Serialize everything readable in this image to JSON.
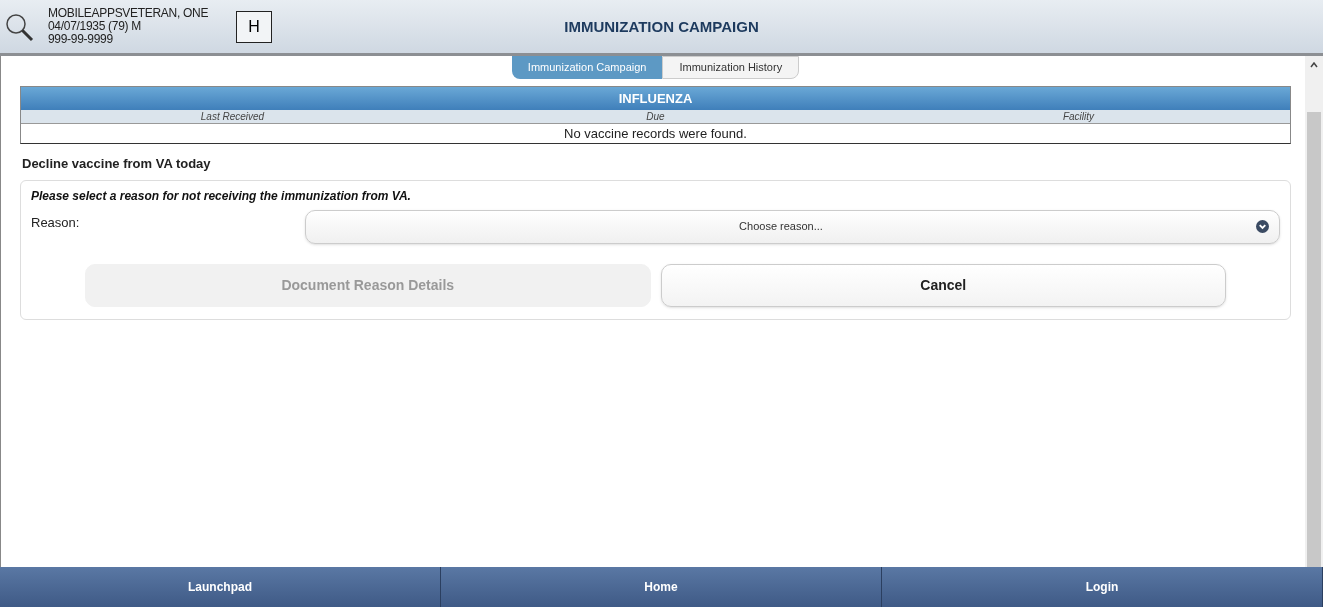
{
  "header": {
    "patient_name": "MOBILEAPPSVETERAN, ONE",
    "patient_dob": "04/07/1935 (79) M",
    "patient_ssn": "999-99-9999",
    "badge": "H",
    "title": "IMMUNIZATION CAMPAIGN"
  },
  "tabs": [
    {
      "label": "Immunization Campaign",
      "selected": true
    },
    {
      "label": "Immunization History",
      "selected": false
    }
  ],
  "vaccine_table": {
    "title": "INFLUENZA",
    "columns": [
      "Last Received",
      "Due",
      "Facility"
    ],
    "empty_message": "No vaccine records were found."
  },
  "decline_section": {
    "heading": "Decline vaccine from VA today",
    "instruction": "Please select a reason for not receiving the immunization from VA.",
    "reason_label": "Reason:",
    "reason_placeholder": "Choose reason...",
    "buttons": [
      {
        "label": "Document Reason Details",
        "disabled": true
      },
      {
        "label": "Cancel",
        "disabled": false
      }
    ]
  },
  "footer": [
    {
      "label": "Launchpad"
    },
    {
      "label": "Home"
    },
    {
      "label": "Login"
    }
  ]
}
